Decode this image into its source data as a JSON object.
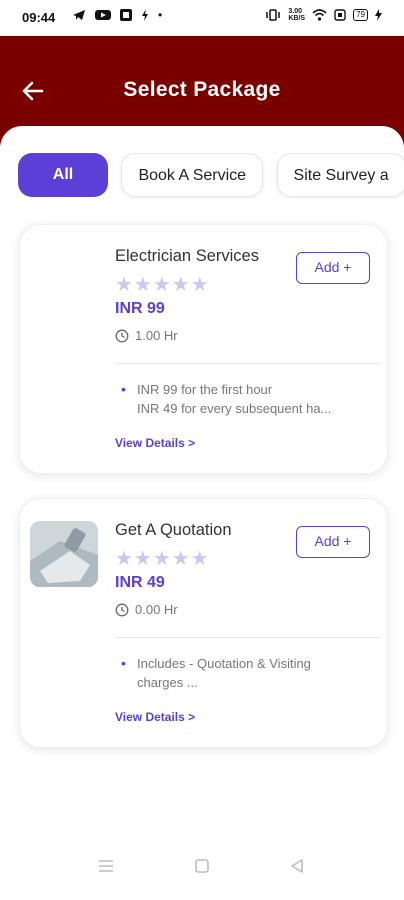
{
  "status_bar": {
    "time": "09:44",
    "net_speed": "3.00\nKB/S",
    "battery": "79"
  },
  "header": {
    "title": "Select Package"
  },
  "tabs": [
    {
      "label": "All",
      "active": true
    },
    {
      "label": "Book A Service",
      "active": false
    },
    {
      "label": "Site Survey a",
      "active": false
    }
  ],
  "packages": [
    {
      "name": "Electrician Services",
      "rating_stars": 5,
      "rating_filled": 0,
      "price": "INR 99",
      "duration": "1.00 Hr",
      "add_label": "Add +",
      "description_lines": [
        "INR 99 for the first hour",
        "INR 49 for every subsequent ha..."
      ],
      "details_label": "View Details >"
    },
    {
      "name": "Get A Quotation",
      "rating_stars": 5,
      "rating_filled": 0,
      "price": "INR 49",
      "duration": "0.00 Hr",
      "add_label": "Add +",
      "description_lines": [
        "Includes - Quotation & Visiting",
        "charges ..."
      ],
      "details_label": "View Details >"
    }
  ],
  "colors": {
    "header": "#7a0000",
    "accent": "#5b3fd6",
    "star_empty": "#c9c9ee"
  },
  "icons": {
    "back": "arrow-left-icon",
    "duration": "clock-icon",
    "nav": [
      "menu-icon",
      "home-square-icon",
      "back-triangle-icon"
    ]
  }
}
